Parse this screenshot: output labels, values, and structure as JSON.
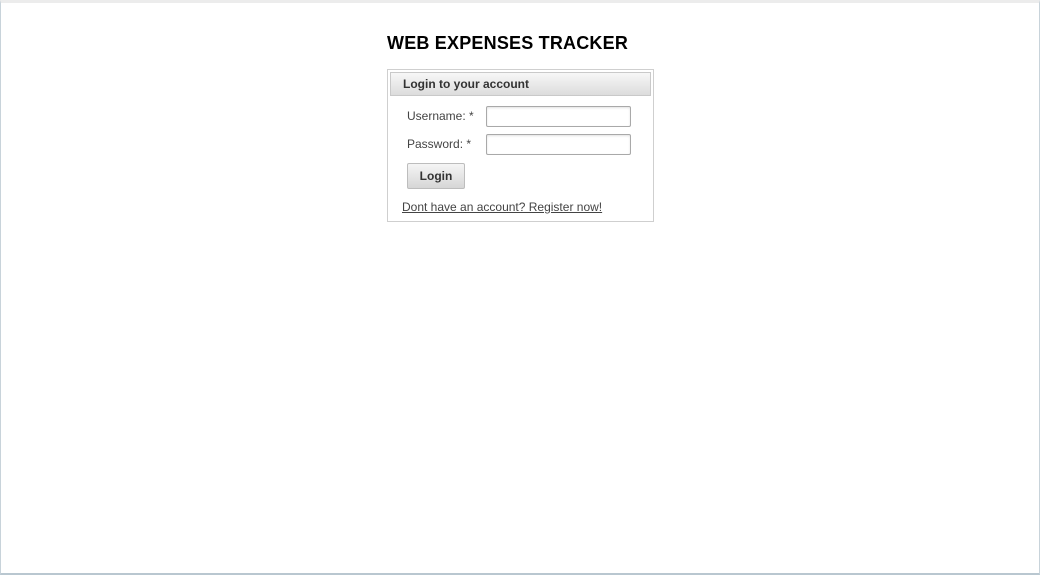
{
  "app": {
    "title": "WEB EXPENSES TRACKER"
  },
  "login_panel": {
    "header": "Login to your account",
    "username_label": "Username:",
    "password_label": "Password:",
    "required_marker": "*",
    "username_value": "",
    "password_value": "",
    "login_button_label": "Login",
    "register_link": "Dont have an account? Register now!"
  }
}
